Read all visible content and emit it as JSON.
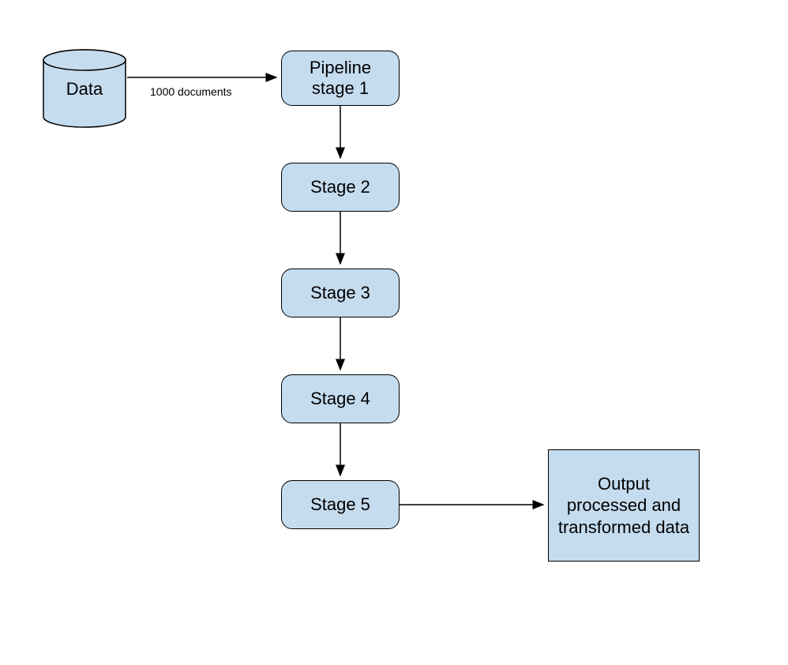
{
  "nodes": {
    "data": {
      "label": "Data"
    },
    "stage1": {
      "label": "Pipeline stage 1"
    },
    "stage2": {
      "label": "Stage 2"
    },
    "stage3": {
      "label": "Stage 3"
    },
    "stage4": {
      "label": "Stage 4"
    },
    "stage5": {
      "label": "Stage 5"
    },
    "output": {
      "label": "Output processed and transformed data"
    }
  },
  "edges": {
    "data_to_stage1": {
      "label": "1000 documents"
    }
  }
}
